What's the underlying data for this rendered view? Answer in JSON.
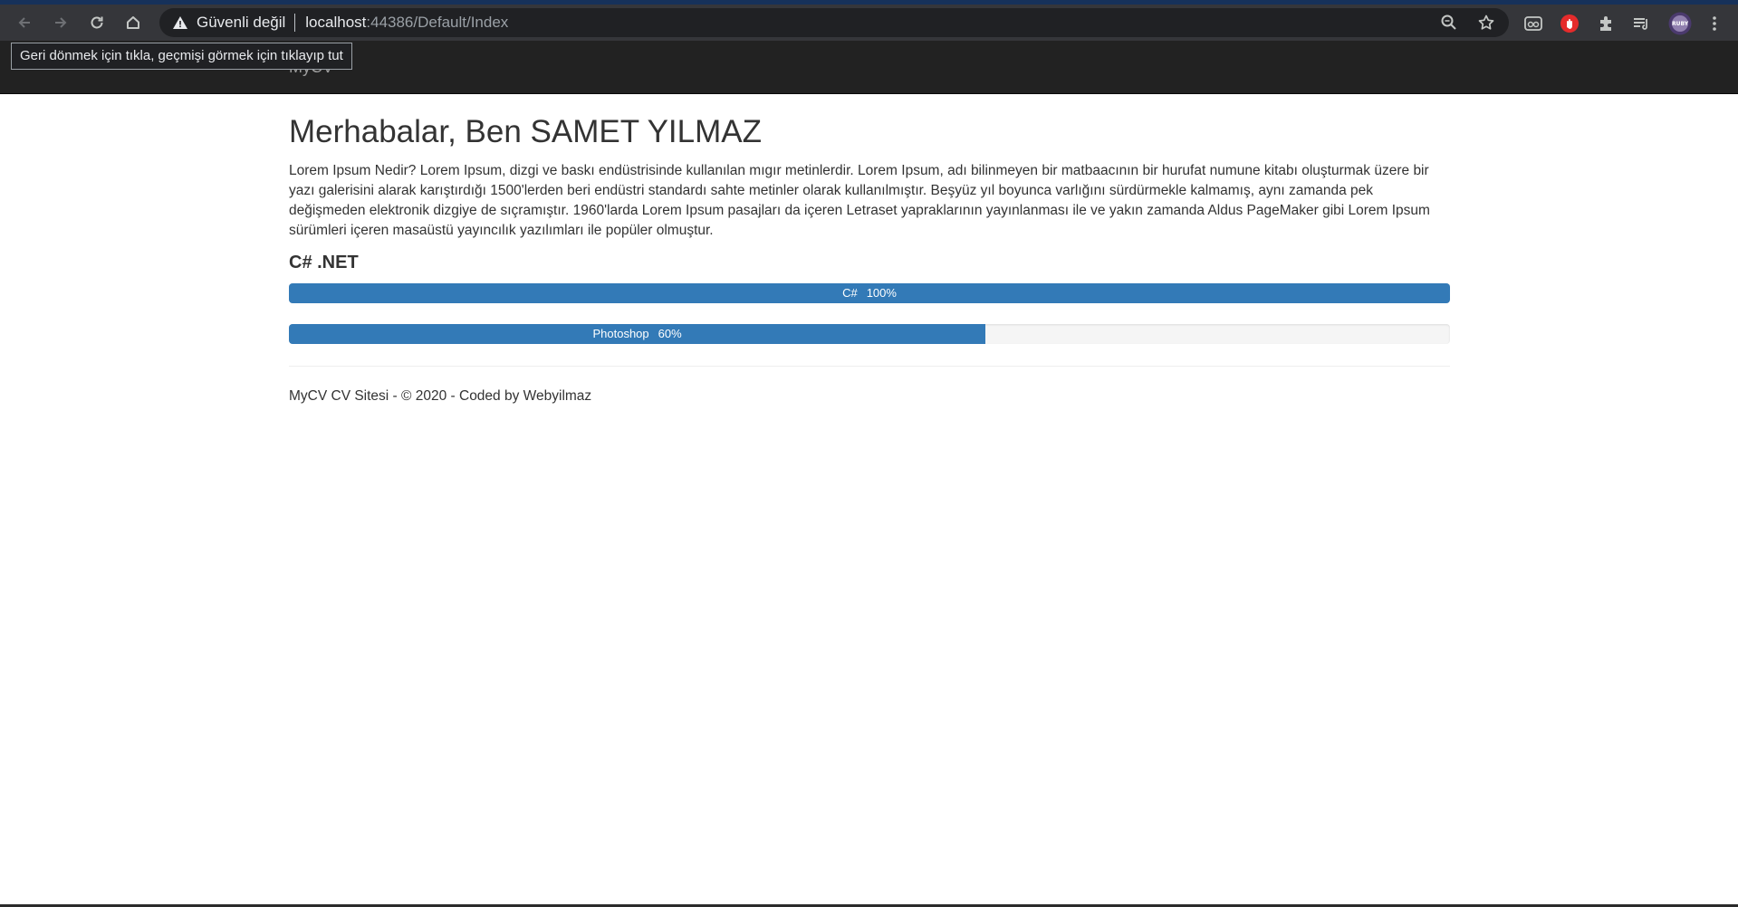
{
  "browser": {
    "security_label": "Güvenli değil",
    "url_host": "localhost",
    "url_rest": ":44386/Default/Index",
    "back_tooltip": "Geri dönmek için tıkla, geçmişi görmek için tıklayıp tut",
    "accent_color": "#4a78c2"
  },
  "navbar": {
    "brand": "MyCV"
  },
  "main": {
    "title": "Merhabalar, Ben SAMET YILMAZ",
    "intro": "Lorem Ipsum Nedir? Lorem Ipsum, dizgi ve baskı endüstrisinde kullanılan mıgır metinlerdir. Lorem Ipsum, adı bilinmeyen bir matbaacının bir hurufat numune kitabı oluşturmak üzere bir yazı galerisini alarak karıştırdığı 1500'lerden beri endüstri standardı sahte metinler olarak kullanılmıştır. Beşyüz yıl boyunca varlığını sürdürmekle kalmamış, aynı zamanda pek değişmeden elektronik dizgiye de sıçramıştır. 1960'larda Lorem Ipsum pasajları da içeren Letraset yapraklarının yayınlanması ile ve yakın zamanda Aldus PageMaker gibi Lorem Ipsum sürümleri içeren masaüstü yayıncılık yazılımları ile popüler olmuştur.",
    "section_title": "C# .NET",
    "skills": [
      {
        "name": "C#",
        "percent_label": "100%",
        "value": 100
      },
      {
        "name": "Photoshop",
        "percent_label": "60%",
        "value": 60
      }
    ],
    "bar_color": "#337ab7"
  },
  "footer": {
    "text": "MyCV CV Sitesi - © 2020 - Coded by Webyilmaz"
  }
}
